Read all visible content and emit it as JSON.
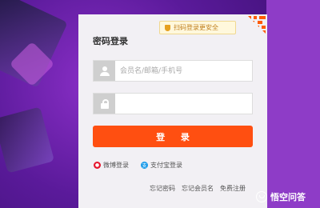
{
  "login": {
    "title": "密码登录",
    "qr_badge": "扫码登录更安全",
    "username": {
      "placeholder": "会员名/邮箱/手机号",
      "value": ""
    },
    "password": {
      "placeholder": "",
      "value": ""
    },
    "submit_label": "登 录",
    "social": [
      {
        "label": "微博登录",
        "icon": "weibo-icon"
      },
      {
        "label": "支付宝登录",
        "icon": "alipay-icon"
      }
    ],
    "links": [
      "忘记密码",
      "忘记会员名",
      "免费注册"
    ]
  },
  "watermark": "悟空问答",
  "colors": {
    "accent": "#ff4f11",
    "background": "#5a1a9a",
    "panel": "#f2f0f4"
  }
}
